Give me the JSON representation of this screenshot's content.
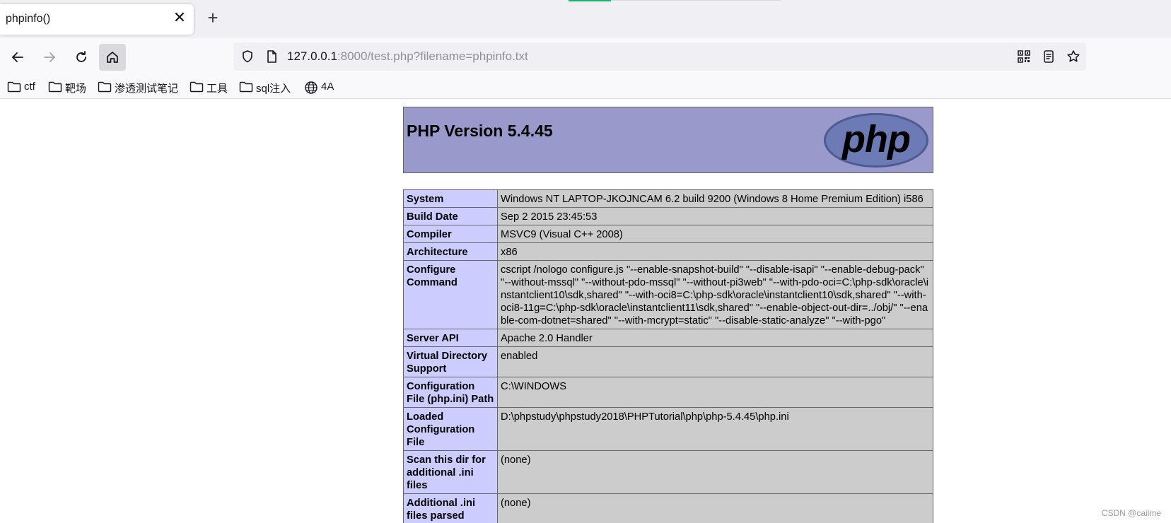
{
  "browser": {
    "tab": {
      "title": "phpinfo()",
      "close_glyph": "✕"
    },
    "new_tab_glyph": "+",
    "url": {
      "host": "127.0.0.1",
      "rest": ":8000/test.php?filename=phpinfo.txt"
    },
    "bookmarks": [
      {
        "label": "ctf",
        "icon": "folder-icon"
      },
      {
        "label": "靶场",
        "icon": "folder-icon"
      },
      {
        "label": "渗透测试笔记",
        "icon": "folder-icon"
      },
      {
        "label": "工具",
        "icon": "folder-icon"
      },
      {
        "label": "sql注入",
        "icon": "folder-icon"
      },
      {
        "label": "4A",
        "icon": "globe-icon"
      }
    ]
  },
  "phpinfo": {
    "title": "PHP Version 5.4.45",
    "logo_text": "php",
    "rows": [
      {
        "label": "System",
        "value": "Windows NT LAPTOP-JKOJNCAM 6.2 build 9200 (Windows 8 Home Premium Edition) i586"
      },
      {
        "label": "Build Date",
        "value": "Sep 2 2015 23:45:53"
      },
      {
        "label": "Compiler",
        "value": "MSVC9 (Visual C++ 2008)"
      },
      {
        "label": "Architecture",
        "value": "x86"
      },
      {
        "label": "Configure Command",
        "value": "cscript /nologo configure.js \"--enable-snapshot-build\" \"--disable-isapi\" \"--enable-debug-pack\" \"--without-mssql\" \"--without-pdo-mssql\" \"--without-pi3web\" \"--with-pdo-oci=C:\\php-sdk\\oracle\\instantclient10\\sdk,shared\" \"--with-oci8=C:\\php-sdk\\oracle\\instantclient10\\sdk,shared\" \"--with-oci8-11g=C:\\php-sdk\\oracle\\instantclient11\\sdk,shared\" \"--enable-object-out-dir=../obj/\" \"--enable-com-dotnet=shared\" \"--with-mcrypt=static\" \"--disable-static-analyze\" \"--with-pgo\""
      },
      {
        "label": "Server API",
        "value": "Apache 2.0 Handler"
      },
      {
        "label": "Virtual Directory Support",
        "value": "enabled"
      },
      {
        "label": "Configuration File (php.ini) Path",
        "value": "C:\\WINDOWS"
      },
      {
        "label": "Loaded Configuration File",
        "value": "D:\\phpstudy\\phpstudy2018\\PHPTutorial\\php\\php-5.4.45\\php.ini"
      },
      {
        "label": "Scan this dir for additional .ini files",
        "value": "(none)"
      },
      {
        "label": "Additional .ini files parsed",
        "value": "(none)"
      }
    ]
  },
  "watermark": "CSDN @cailme",
  "colors": {
    "header_bg": "#9999cc",
    "label_bg": "#ccccff",
    "value_bg": "#cccccc",
    "border": "#666666"
  }
}
